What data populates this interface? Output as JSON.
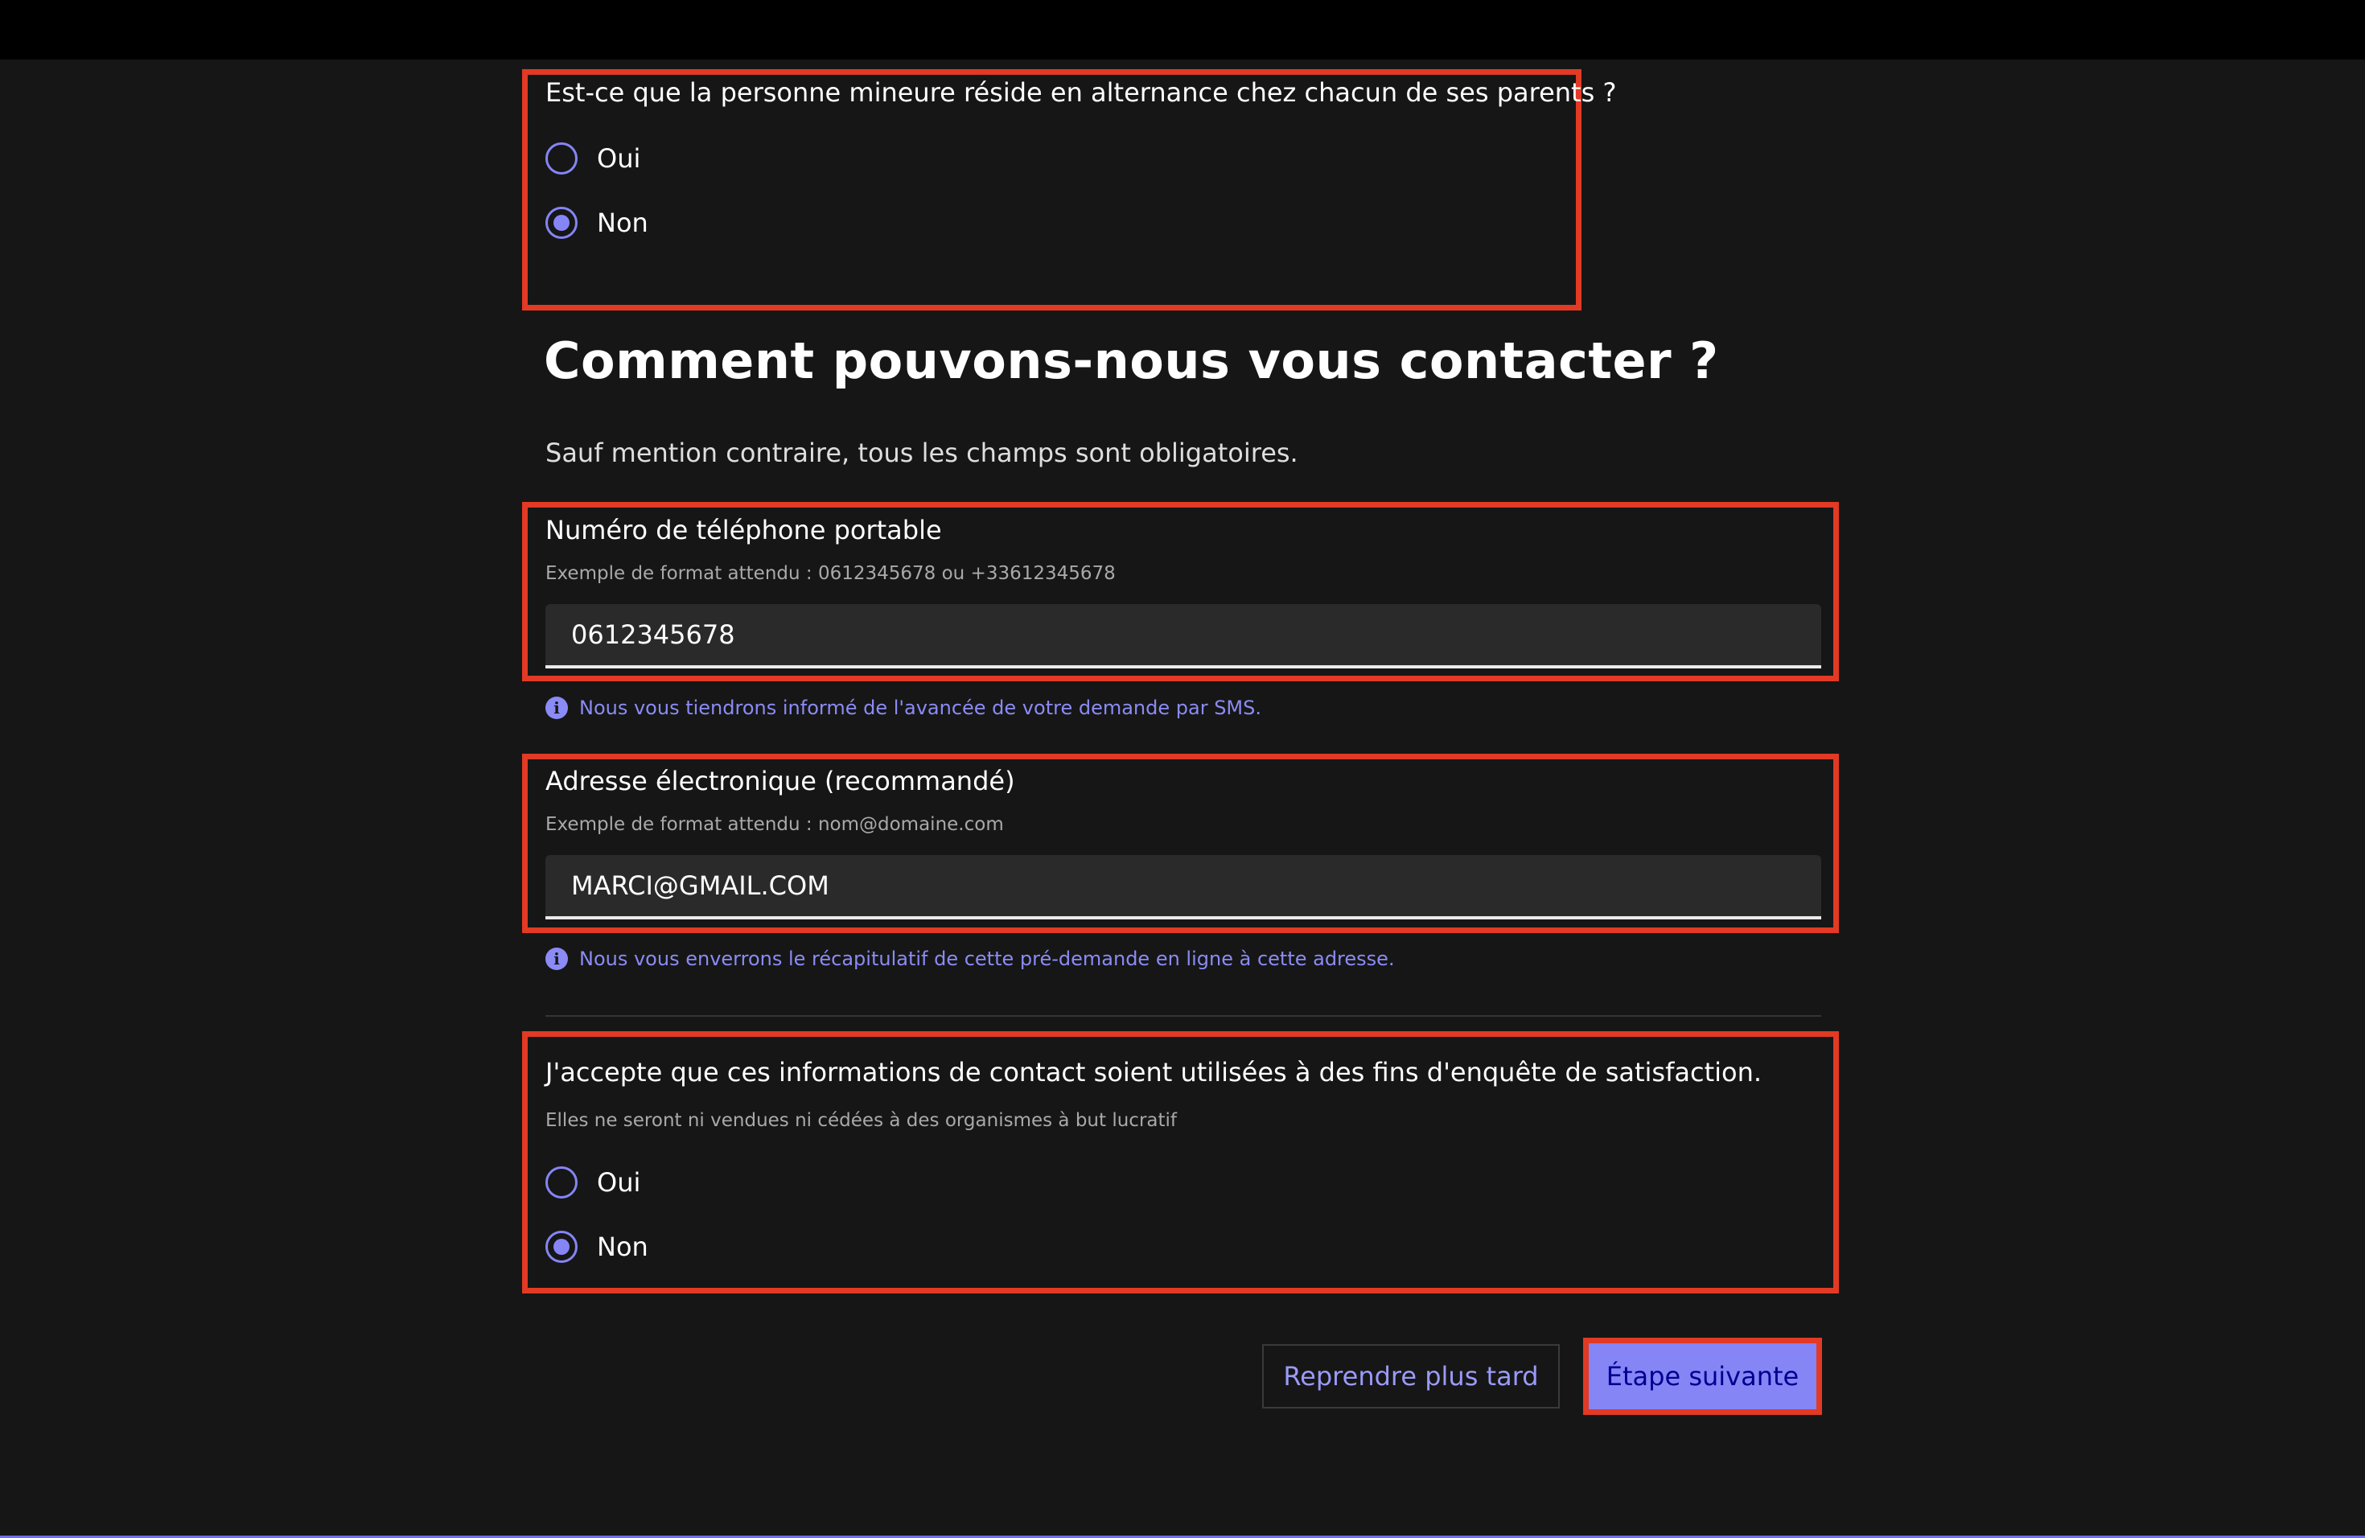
{
  "residence_question": {
    "text": "Est-ce que la personne mineure réside en alternance chez chacun de ses parents ?",
    "options": [
      {
        "label": "Oui",
        "selected": false
      },
      {
        "label": "Non",
        "selected": true
      }
    ]
  },
  "contact_section": {
    "heading": "Comment pouvons-nous vous contacter ?",
    "subtitle": "Sauf mention contraire, tous les champs sont obligatoires."
  },
  "phone_field": {
    "label": "Numéro de téléphone portable",
    "hint": "Exemple de format attendu : 0612345678 ou +33612345678",
    "value": "0612345678",
    "info": "Nous vous tiendrons informé de l'avancée de votre demande par SMS."
  },
  "email_field": {
    "label": "Adresse électronique (recommandé)",
    "hint": "Exemple de format attendu : nom@domaine.com",
    "value": "MARCI@GMAIL.COM",
    "info": "Nous vous enverrons le récapitulatif de cette pré-demande en ligne à cette adresse."
  },
  "survey_question": {
    "text": "J'accepte que ces informations de contact soient utilisées à des fins d'enquête de satisfaction.",
    "hint": "Elles ne seront ni vendues ni cédées à des organismes à but lucratif",
    "options": [
      {
        "label": "Oui",
        "selected": false
      },
      {
        "label": "Non",
        "selected": true
      }
    ]
  },
  "actions": {
    "later_label": "Reprendre plus tard",
    "next_label": "Étape suivante"
  },
  "icons": {
    "info": "info-icon",
    "radio": "radio-icon"
  },
  "colors": {
    "accent": "#8585f6",
    "highlight": "#e23a24",
    "background": "#161616"
  }
}
